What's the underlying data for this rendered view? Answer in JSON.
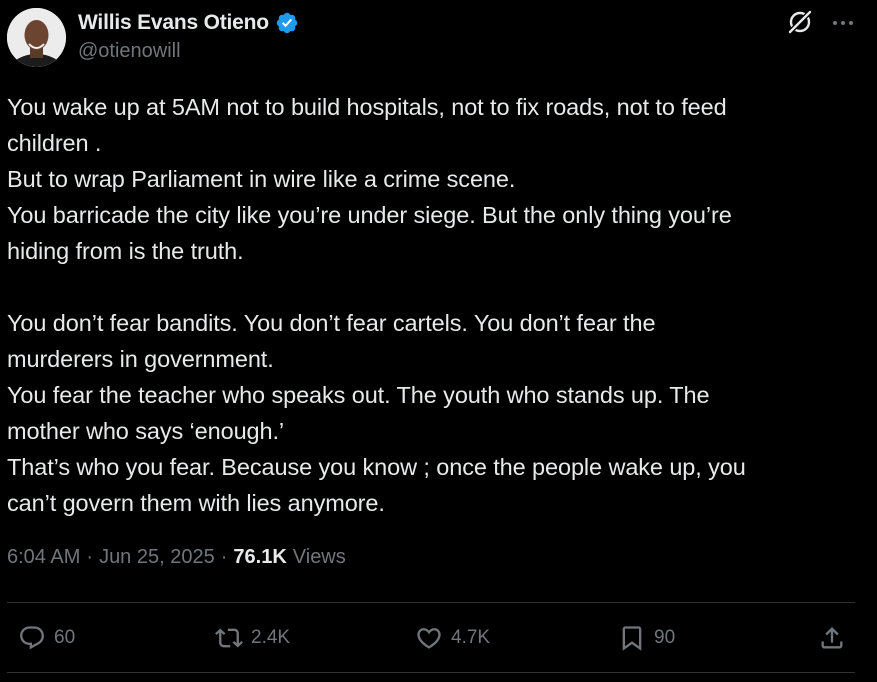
{
  "author": {
    "display_name": "Willis Evans Otieno",
    "handle": "@otienowill",
    "verified": true
  },
  "tweet": {
    "lines": [
      "You wake up at 5AM not to build hospitals, not to fix roads, not to feed",
      "children .",
      "But to wrap Parliament in wire like a crime scene.",
      "You barricade the city like you’re under siege. But the only thing you’re",
      "hiding from is the truth.",
      "",
      "You don’t fear bandits. You don’t fear cartels. You don’t fear the",
      "murderers in government.",
      "You fear the teacher who speaks out. The youth who stands up. The",
      "mother who says ‘enough.’",
      "That’s who you fear. Because you know ; once the people wake up, you",
      "can’t govern them with lies anymore."
    ]
  },
  "meta": {
    "time": "6:04 AM",
    "separator": "·",
    "date": "Jun 25, 2025",
    "views_count": "76.1K",
    "views_label": "Views"
  },
  "actions": {
    "replies": "60",
    "reposts": "2.4K",
    "likes": "4.7K",
    "bookmarks": "90"
  },
  "icons": {
    "verified": "verified-badge-icon",
    "grok": "grok-icon",
    "more": "more-icon",
    "reply": "reply-icon",
    "repost": "repost-icon",
    "like": "heart-icon",
    "bookmark": "bookmark-icon",
    "share": "share-icon"
  },
  "colors": {
    "background": "#000000",
    "text_primary": "#e7e9ea",
    "text_secondary": "#71767b",
    "verified": "#1d9bf0",
    "divider": "#2f3336"
  }
}
